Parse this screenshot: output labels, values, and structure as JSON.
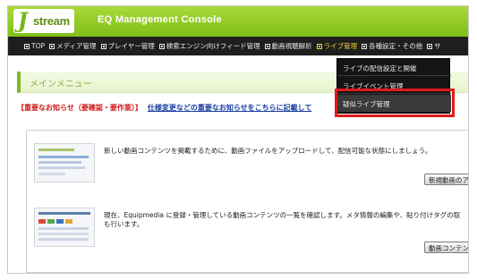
{
  "header": {
    "logo_mark": "J",
    "logo_text": "stream",
    "title": "EQ Management Console",
    "brand_color": "#7fbf16"
  },
  "nav": {
    "items": [
      {
        "label": "TOP"
      },
      {
        "label": "メディア管理"
      },
      {
        "label": "プレイヤー管理"
      },
      {
        "label": "検索エンジン向けフィード管理"
      },
      {
        "label": "動画視聴解析"
      },
      {
        "label": "ライブ管理",
        "active": true
      },
      {
        "label": "各種設定・その他"
      },
      {
        "label": "サ"
      }
    ]
  },
  "live_dropdown": {
    "items": [
      {
        "label": "ライブの配信設定と開催"
      },
      {
        "label": "ライブイベント管理"
      },
      {
        "label": "疑似ライブ管理"
      }
    ]
  },
  "main": {
    "menu_title": "メインメニュー",
    "notice_label": "【重要なお知らせ（要確認・要作業）】",
    "notice_link": "仕様変更などの重要なお知らせをこちらに記載して",
    "sections": [
      {
        "description": "新しい動画コンテンツを掲載するために、動画ファイルをアップロードして、配信可能な状態にしましょう。",
        "button": "新規動画のア"
      },
      {
        "description_line1": "現在、Equipmedia に登録・管理している動画コンテンツの一覧を確認します。メタ情報の編集や、貼り付けタグの取",
        "description_line2": "も行います。",
        "button": "動画コンテン"
      }
    ]
  },
  "colors": {
    "highlight": "#e21a1a",
    "notice_red": "#d01818",
    "link_blue": "#1a3ea0"
  }
}
